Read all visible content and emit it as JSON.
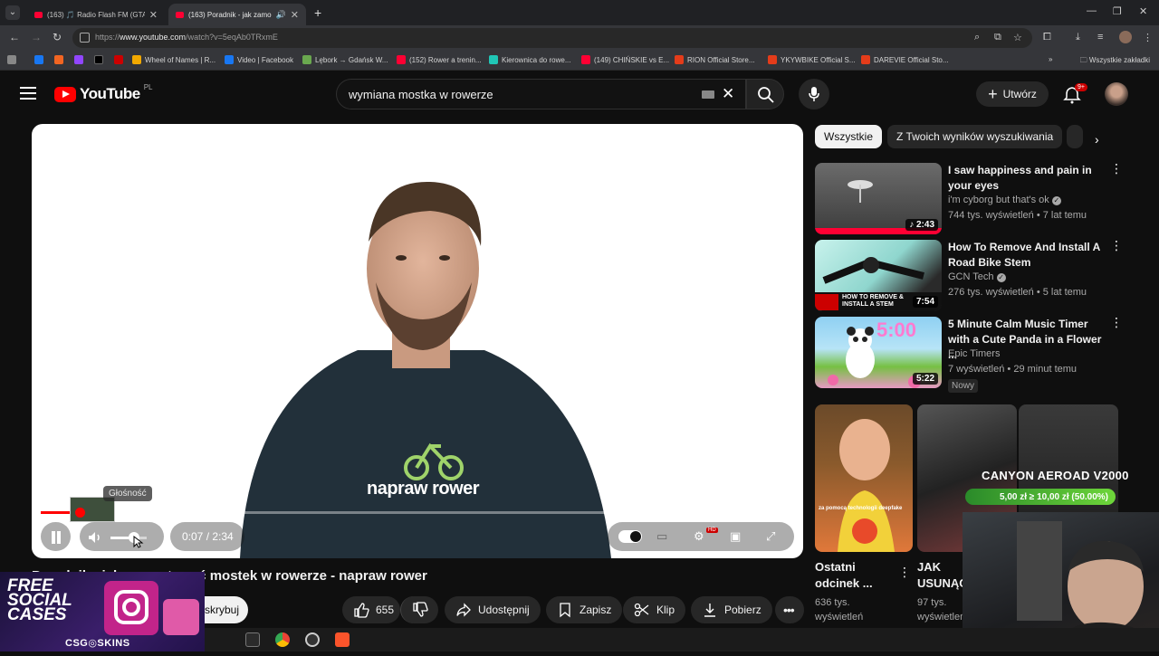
{
  "browser": {
    "tabs": [
      {
        "label": "(163) 🎵 Radio Flash FM (GTA V",
        "active": false
      },
      {
        "label": "(163) Poradnik - jak zamont",
        "active": true
      }
    ],
    "url_prefix": "https://",
    "url_domain": "www.youtube.com",
    "url_path": "/watch?v=5eqAb0TRxmE",
    "bookmarks": [
      {
        "label": "",
        "color": "#1877f2"
      },
      {
        "label": "",
        "color": "#f26522"
      },
      {
        "label": "",
        "color": "#9146ff"
      },
      {
        "label": "",
        "color": "#000000"
      },
      {
        "label": "",
        "color": "#cc0000"
      },
      {
        "label": "Wheel of Names | R...",
        "color": "#f2a900"
      },
      {
        "label": "Video | Facebook",
        "color": "#1877f2"
      },
      {
        "label": "Lębork → Gdańsk W...",
        "color": "#6aa84f"
      },
      {
        "label": "(152) Rower a trenin...",
        "color": "#ff0033"
      },
      {
        "label": "Kierownica do rowe...",
        "color": "#20c6b6"
      },
      {
        "label": "(149) CHIŃSKIE vs E...",
        "color": "#ff0033"
      },
      {
        "label": "RION Official Store...",
        "color": "#e43c1a"
      },
      {
        "label": "YKYWBIKE Official S...",
        "color": "#e43c1a"
      },
      {
        "label": "DAREVIE Official Sto...",
        "color": "#e43c1a"
      }
    ],
    "all_bookmarks": "Wszystkie zakładki"
  },
  "header": {
    "logo_text": "YouTube",
    "country_code": "PL",
    "search_query": "wymiana mostka w rowerze",
    "create_label": "Utwórz",
    "notification_count": "9+"
  },
  "player": {
    "shirt_brand": "napraw rower",
    "tooltip": "Głośność",
    "current_time": "0:07",
    "duration": "2:34",
    "time_display": "0:07 / 2:34",
    "progress": 0.045,
    "volume": 0.5,
    "hd_badge": "HD"
  },
  "video": {
    "title": "Poradnik - jak zamontować mostek w rowerze - napraw rower",
    "subscribe_fragment": "skrybuj",
    "likes": "655",
    "share_label": "Udostępnij",
    "save_label": "Zapisz",
    "clip_label": "Klip",
    "download_label": "Pobierz"
  },
  "sidebar": {
    "chips": [
      "Wszystkie",
      "Z Twoich wyników wyszukiwania"
    ],
    "recommendations": [
      {
        "title_line1": "I saw happiness and pain in",
        "title_line2": "your eyes",
        "channel": "i'm cyborg but that's ok",
        "meta": "744 tys. wyświetleń • 7 lat temu",
        "duration": "2:43"
      },
      {
        "title_line1": "How To Remove And Install A",
        "title_line2": "Road Bike Stem",
        "channel": "GCN Tech",
        "meta": "276 tys. wyświetleń • 5 lat temu",
        "duration": "7:54",
        "thumb_caption": "HOW TO REMOVE & INSTALL A STEM"
      },
      {
        "title_line1": "5 Minute Calm Music Timer",
        "title_line2": "with a Cute Panda in a Flower ...",
        "channel": "Epic Timers",
        "meta": "7 wyświetleń • 29 minut temu",
        "duration": "5:22",
        "thumb_caption": "5:00",
        "badge": "Nowy"
      }
    ],
    "shorts": [
      {
        "title_line1": "Ostatni",
        "title_line2": "odcinek ...",
        "views_line1": "636 tys.",
        "views_line2": "wyświetleń",
        "caption": "za pomocą technologii deepfake"
      },
      {
        "title_line1": "JAK",
        "title_line2": "USUNĄĆ",
        "views_line1": "97 tys.",
        "views_line2": "wyświetleń"
      }
    ]
  },
  "overlay": {
    "promo_title": "CANYON AEROAD V2000",
    "promo_price": "5,00 zł ≥ 10,00 zł (50.00%)",
    "ad_line1": "FREE",
    "ad_line2": "SOCIAL",
    "ad_line3": "CASES",
    "ad_brand": "CSG◎SKINS"
  }
}
